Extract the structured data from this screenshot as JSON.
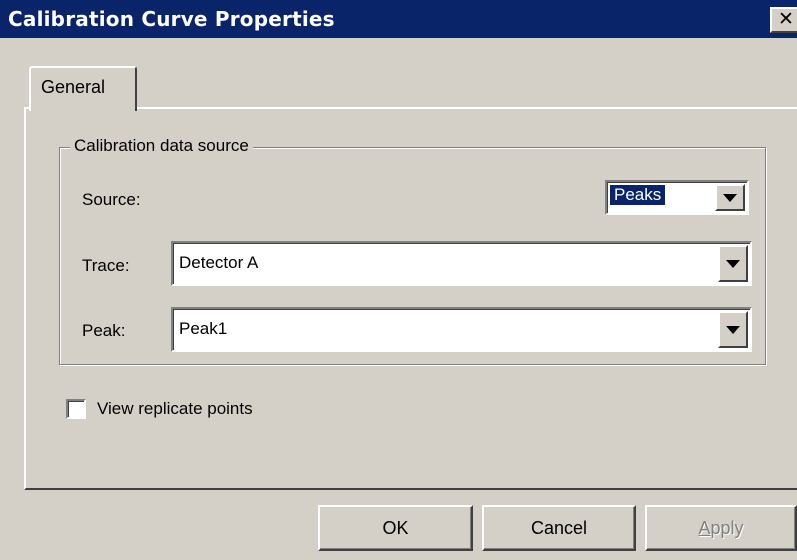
{
  "window": {
    "title": "Calibration Curve Properties",
    "close_icon": "✕"
  },
  "tabs": [
    {
      "label": "General"
    }
  ],
  "group": {
    "legend": "Calibration data source",
    "source_label": "Source:",
    "source_value": "Peaks",
    "trace_label": "Trace:",
    "trace_value": "Detector A",
    "peak_label": "Peak:",
    "peak_value": "Peak1"
  },
  "options": {
    "view_replicates_label": "View replicate points",
    "view_replicates_checked": false
  },
  "buttons": {
    "ok": "OK",
    "cancel": "Cancel",
    "apply": "Apply"
  },
  "colors": {
    "titlebar": "#0a246a",
    "face": "#d4d0c8",
    "selection": "#0a246a"
  }
}
